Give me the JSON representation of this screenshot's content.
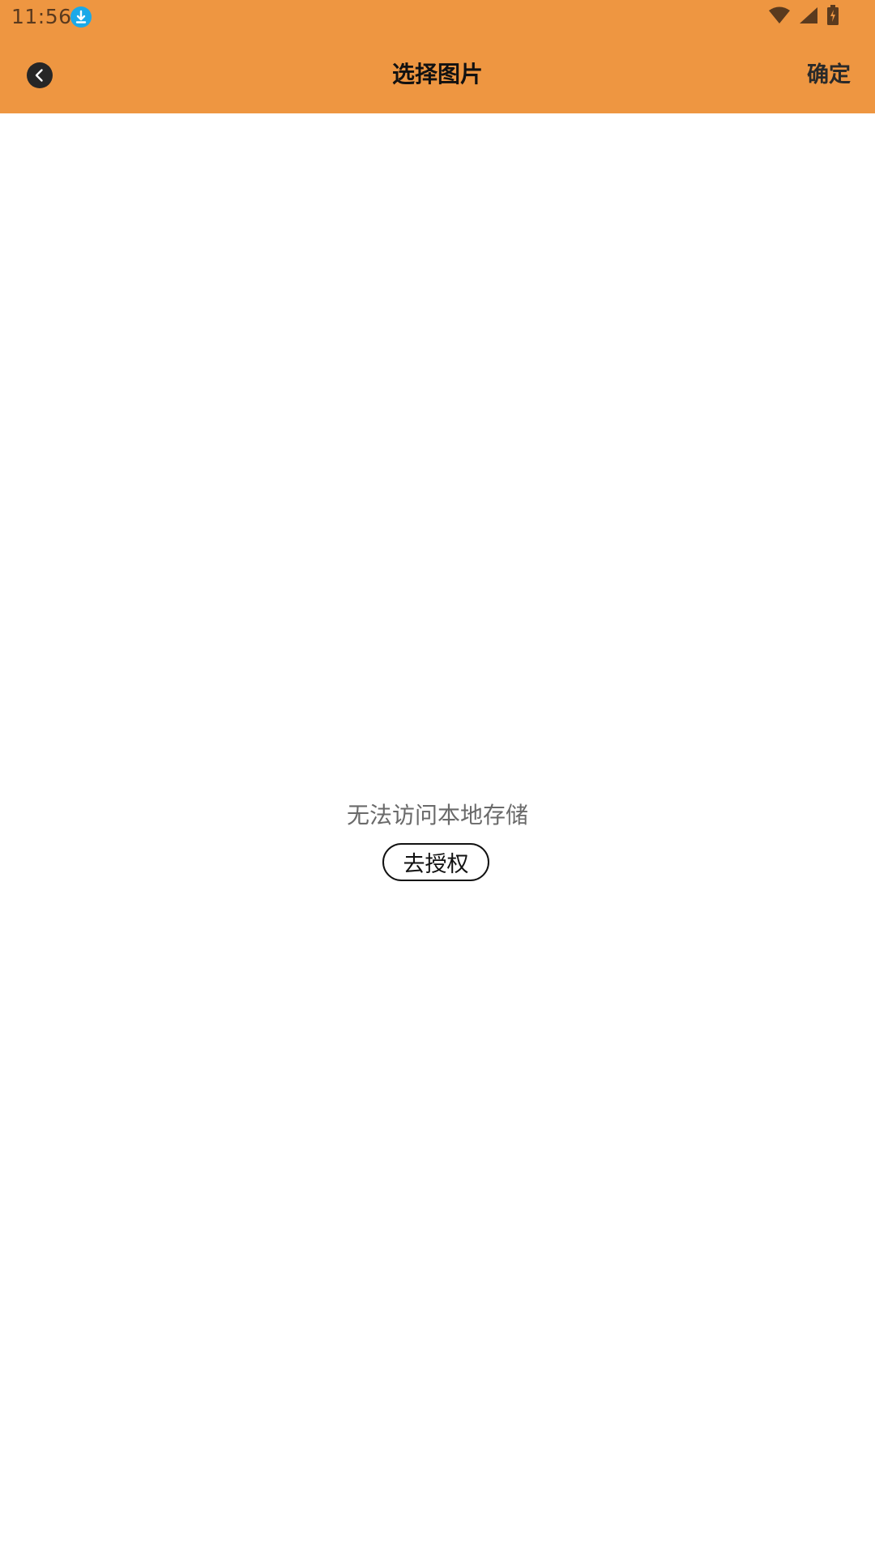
{
  "status_bar": {
    "time": "11:56",
    "icons": [
      "download-notification-icon",
      "wifi-icon",
      "cell-signal-icon",
      "battery-charging-icon"
    ]
  },
  "toolbar": {
    "title": "选择图片",
    "confirm_label": "确定",
    "back_icon": "back-arrow-icon"
  },
  "empty_state": {
    "message": "无法访问本地存储",
    "authorize_label": "去授权"
  },
  "colors": {
    "header_bg": "#EE9641",
    "download_badge": "#1BA9E8",
    "back_button_bg": "#262626"
  }
}
